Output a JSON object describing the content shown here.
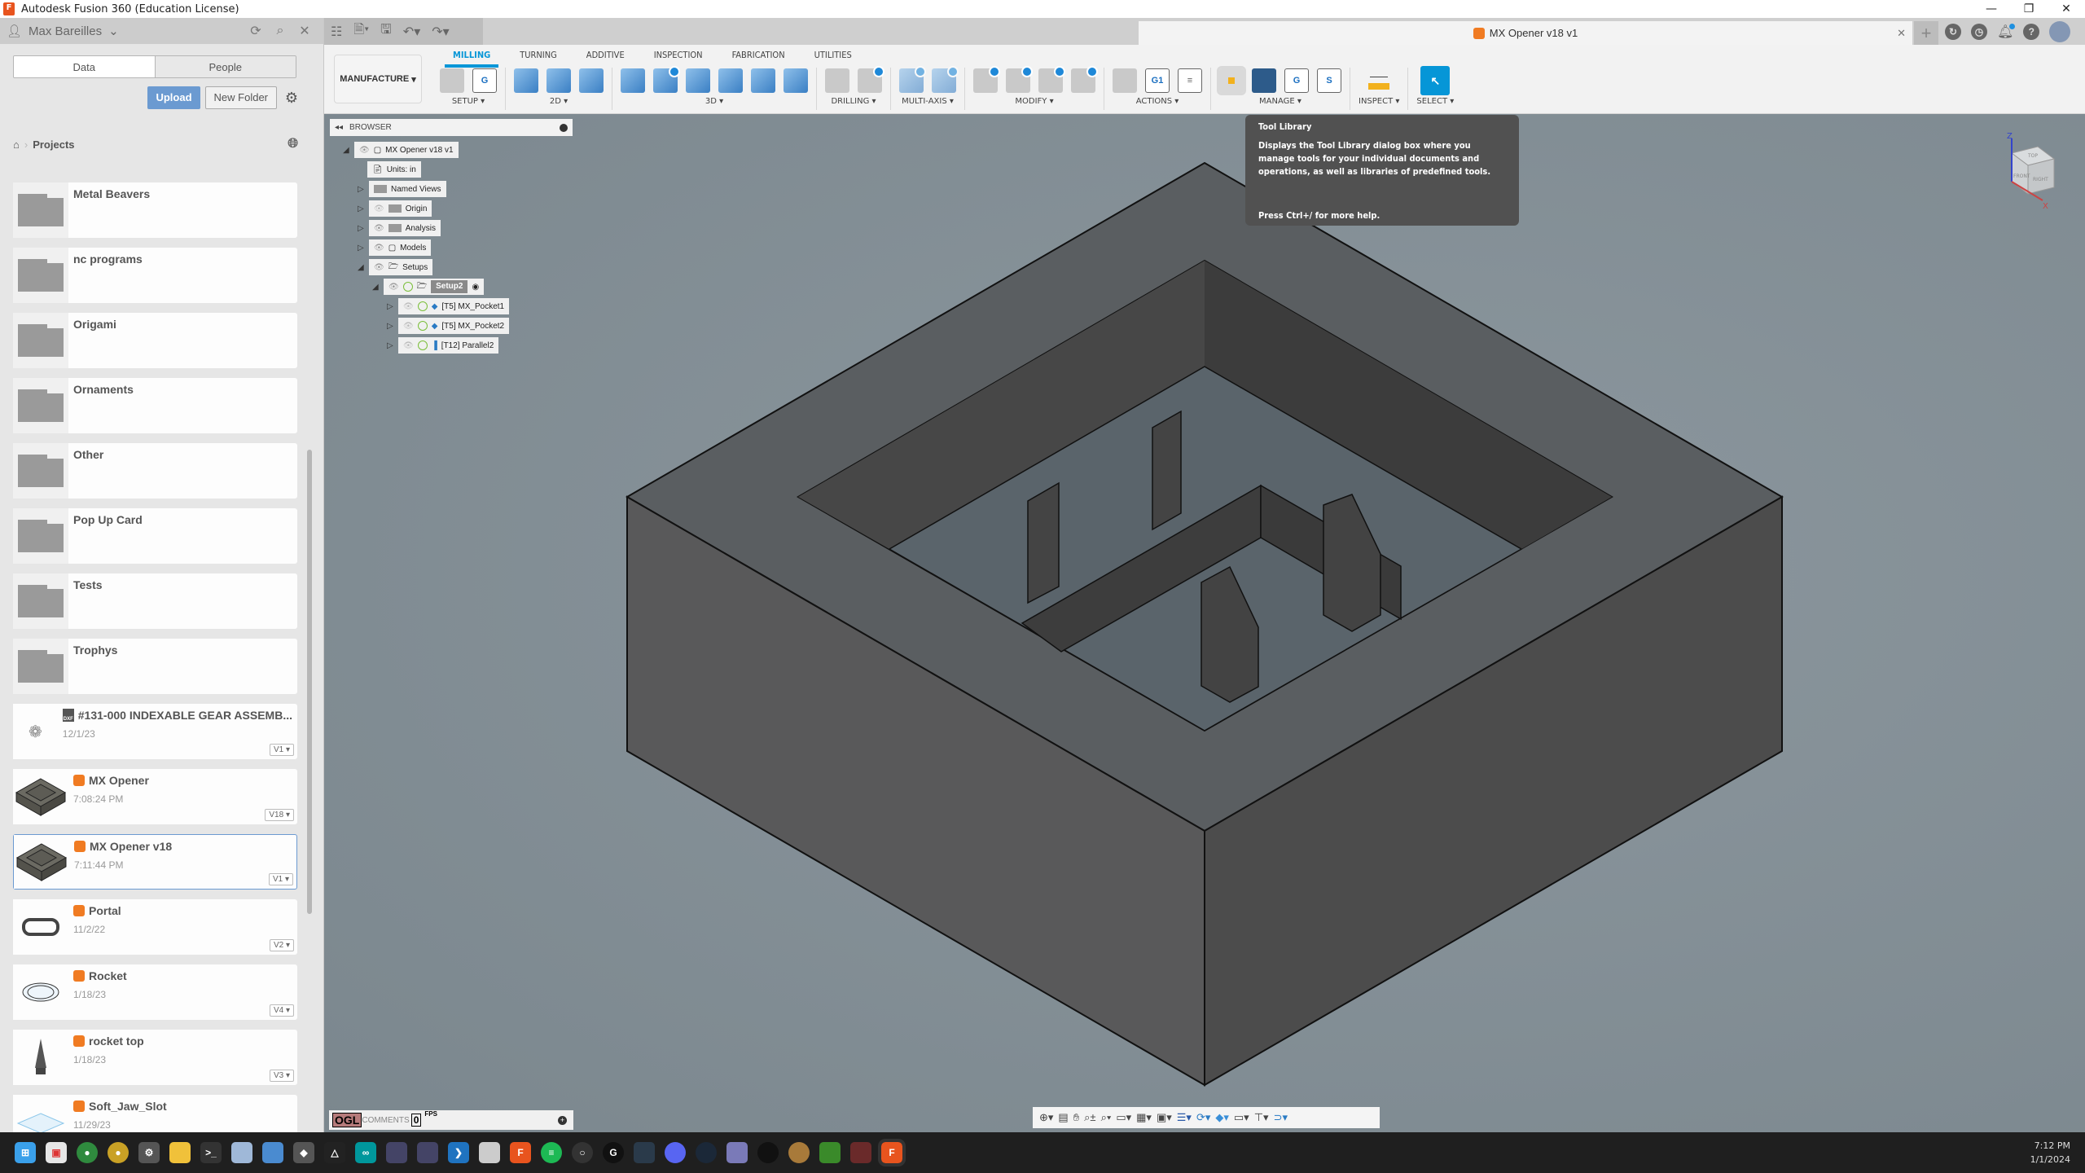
{
  "window": {
    "title": "Autodesk Fusion 360 (Education License)",
    "app_icon": "fusion-360-icon",
    "controls": [
      "minimize-icon",
      "restore-icon",
      "close-icon"
    ]
  },
  "data_panel": {
    "user_name": "Max Bareilles",
    "header_icons": [
      "refresh-icon",
      "search-icon",
      "close-icon"
    ],
    "tabs": [
      {
        "label": "Data",
        "active": true
      },
      {
        "label": "People",
        "active": false
      }
    ],
    "upload_label": "Upload",
    "new_folder_label": "New Folder",
    "breadcrumb": {
      "home_icon": "home-icon",
      "current": "Projects"
    },
    "items": [
      {
        "type": "folder",
        "name": "Metal Beavers"
      },
      {
        "type": "folder",
        "name": "nc programs"
      },
      {
        "type": "folder",
        "name": "Origami"
      },
      {
        "type": "folder",
        "name": "Ornaments"
      },
      {
        "type": "folder",
        "name": "Other"
      },
      {
        "type": "folder",
        "name": "Pop Up Card"
      },
      {
        "type": "folder",
        "name": "Tests"
      },
      {
        "type": "folder",
        "name": "Trophys"
      },
      {
        "type": "dxf",
        "name": "#131-000 INDEXABLE GEAR ASSEMB...",
        "date": "12/1/23",
        "version": "V1"
      },
      {
        "type": "design",
        "name": "MX Opener",
        "date": "7:08:24 PM",
        "version": "V18"
      },
      {
        "type": "design",
        "name": "MX Opener v18",
        "date": "7:11:44 PM",
        "version": "V1",
        "selected": true
      },
      {
        "type": "design",
        "name": "Portal",
        "date": "11/2/22",
        "version": "V2"
      },
      {
        "type": "design",
        "name": "Rocket",
        "date": "1/18/23",
        "version": "V4"
      },
      {
        "type": "design",
        "name": "rocket top",
        "date": "1/18/23",
        "version": "V3"
      },
      {
        "type": "design",
        "name": "Soft_Jaw_Slot",
        "date": "11/29/23",
        "version": ""
      }
    ]
  },
  "app_toolbar": {
    "document_tab": "MX Opener v18 v1",
    "right_icons": [
      "new-tab-icon",
      "job-status-icon",
      "history-icon",
      "notifications-icon",
      "help-icon",
      "account-avatar"
    ]
  },
  "ribbon": {
    "workspace": "MANUFACTURE",
    "tabs": [
      {
        "label": "MILLING",
        "active": true
      },
      {
        "label": "TURNING"
      },
      {
        "label": "ADDITIVE"
      },
      {
        "label": "INSPECTION"
      },
      {
        "label": "FABRICATION"
      },
      {
        "label": "UTILITIES"
      }
    ],
    "groups": [
      {
        "label": "SETUP",
        "icons": [
          "new-setup-icon",
          "nc-program-icon"
        ]
      },
      {
        "label": "2D",
        "icons": [
          "2d-adaptive-icon",
          "2d-pocket-icon",
          "face-icon"
        ]
      },
      {
        "label": "3D",
        "icons": [
          "adaptive-clearing-icon",
          "pocket-clearing-icon",
          "steep-shallow-icon",
          "parallel-icon",
          "scallop-icon",
          "contour-icon"
        ]
      },
      {
        "label": "DRILLING",
        "icons": [
          "drill-icon",
          "hole-recognition-icon"
        ]
      },
      {
        "label": "MULTI-AXIS",
        "icons": [
          "swarf-icon",
          "multi-axis-contour-icon"
        ]
      },
      {
        "label": "MODIFY",
        "icons": [
          "trim-icon",
          "delete-toolpath-icon",
          "tool-orientation-icon",
          "pattern-icon"
        ]
      },
      {
        "label": "ACTIONS",
        "icons": [
          "simulate-icon",
          "post-process-icon",
          "setup-sheet-icon"
        ]
      },
      {
        "label": "MANAGE",
        "icons": [
          "tool-library-icon",
          "machine-library-icon",
          "post-library-icon",
          "template-library-icon"
        ]
      },
      {
        "label": "INSPECT",
        "icons": [
          "measure-icon"
        ]
      },
      {
        "label": "SELECT",
        "icons": [
          "select-icon"
        ]
      }
    ]
  },
  "browser": {
    "title": "BROWSER",
    "nodes": [
      {
        "label": "MX Opener v18 v1",
        "level": 0,
        "expanded": true
      },
      {
        "label": "Units: in",
        "level": 1
      },
      {
        "label": "Named Views",
        "level": 1,
        "expanded": false
      },
      {
        "label": "Origin",
        "level": 1,
        "expanded": false,
        "hidden": true
      },
      {
        "label": "Analysis",
        "level": 1,
        "expanded": false
      },
      {
        "label": "Models",
        "level": 1,
        "expanded": false
      },
      {
        "label": "Setups",
        "level": 1,
        "expanded": true
      },
      {
        "label": "Setup2",
        "level": 2,
        "expanded": true,
        "active": true
      },
      {
        "label": "[T5] MX_Pocket1",
        "level": 3,
        "expanded": false
      },
      {
        "label": "[T5] MX_Pocket2",
        "level": 3,
        "expanded": false
      },
      {
        "label": "[T12] Parallel2",
        "level": 3,
        "expanded": false
      }
    ]
  },
  "tooltip": {
    "title": "Tool Library",
    "body": "Displays the Tool Library dialog box where you manage tools for your individual documents and operations, as well as libraries of predefined tools.",
    "footer": "Press Ctrl+/ for more help."
  },
  "viewcube": {
    "faces": [
      "TOP",
      "FRONT",
      "RIGHT"
    ],
    "axes": [
      "Z",
      "X"
    ]
  },
  "comments": {
    "label": "COMMENTS",
    "ogl": "OGL",
    "fps_value": "0",
    "fps_label": "FPS"
  },
  "nav_bar": {
    "icons": [
      "orbit-icon",
      "look-at-icon",
      "pan-icon",
      "zoom-icon",
      "fit-icon",
      "display-settings-icon",
      "grid-icon",
      "viewports-icon",
      "stock-display-icon",
      "refresh-icon",
      "object-visibility-icon",
      "machine-icon",
      "tool-display-icon",
      "toolpath-display-icon"
    ]
  },
  "taskbar": {
    "apps": [
      "start",
      "store",
      "chrome-profile",
      "chrome",
      "settings",
      "file-explorer",
      "terminal",
      "task-manager",
      "control-panel",
      "unity",
      "affinity",
      "arduino",
      "network",
      "vpn",
      "vscode",
      "python",
      "fusion-360",
      "spotify",
      "obs",
      "logitech",
      "davinci-resolve",
      "discord",
      "steam",
      "game",
      "music",
      "blender",
      "minecraft",
      "game2",
      "fusion-360-active"
    ],
    "time": "7:12 PM",
    "date": "1/1/2024"
  }
}
